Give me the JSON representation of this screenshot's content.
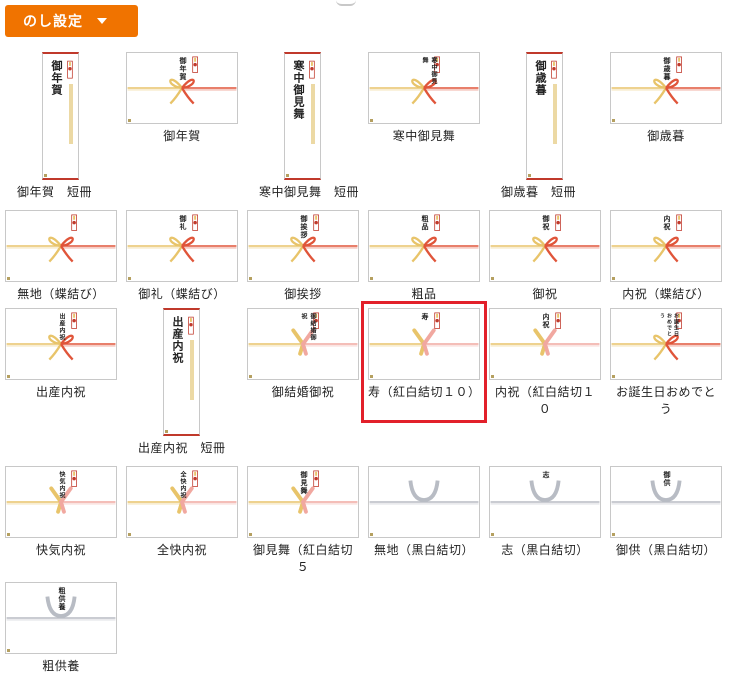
{
  "header": {
    "button_label": "のし設定"
  },
  "noshi": [
    {
      "caption": "御年賀　短冊",
      "text": "御年賀",
      "style": "tanzaku"
    },
    {
      "caption": "御年賀",
      "text": "御年賀",
      "style": "chou"
    },
    {
      "caption": "寒中御見舞　短冊",
      "text": "寒中御見舞",
      "style": "tanzaku"
    },
    {
      "caption": "寒中御見舞",
      "text": "寒中御見舞",
      "style": "chou"
    },
    {
      "caption": "御歳暮　短冊",
      "text": "御歳暮",
      "style": "tanzaku"
    },
    {
      "caption": "御歳暮",
      "text": "御歳暮",
      "style": "chou"
    },
    {
      "caption": "無地（蝶結び）",
      "text": "",
      "style": "chou"
    },
    {
      "caption": "御礼（蝶結び）",
      "text": "御礼",
      "style": "chou"
    },
    {
      "caption": "御挨拶",
      "text": "御挨拶",
      "style": "chou"
    },
    {
      "caption": "粗品",
      "text": "粗品",
      "style": "chou"
    },
    {
      "caption": "御祝",
      "text": "御祝",
      "style": "chou"
    },
    {
      "caption": "内祝（蝶結び）",
      "text": "内祝",
      "style": "chou"
    },
    {
      "caption": "出産内祝",
      "text": "出産内祝",
      "style": "chou"
    },
    {
      "caption": "出産内祝　短冊",
      "text": "出産内祝",
      "style": "tanzaku"
    },
    {
      "caption": "御結婚御祝",
      "text": "御結婚御祝",
      "style": "musubi"
    },
    {
      "caption": "寿（紅白結切１０）",
      "text": "寿",
      "style": "musubi"
    },
    {
      "caption": "内祝（紅白結切１０",
      "text": "内祝",
      "style": "musubi"
    },
    {
      "caption": "お誕生日おめでとう",
      "text": "お誕生日おめでとう",
      "style": "chou"
    },
    {
      "caption": "快気内祝",
      "text": "快気内祝",
      "style": "musubi"
    },
    {
      "caption": "全快内祝",
      "text": "全快内祝",
      "style": "musubi"
    },
    {
      "caption": "御見舞（紅白結切５",
      "text": "御見舞",
      "style": "musubi"
    },
    {
      "caption": "無地（黒白結切）",
      "text": "",
      "style": "kuro"
    },
    {
      "caption": "志（黒白結切）",
      "text": "志",
      "style": "kuro"
    },
    {
      "caption": "御供（黒白結切）",
      "text": "御供",
      "style": "kuro"
    },
    {
      "caption": "粗供養",
      "text": "粗供養",
      "style": "kuro"
    }
  ],
  "selected_index": 15,
  "colors": {
    "accent": "#f07300",
    "selection": "#e2202a",
    "red_mizuhiki": "#e0553a",
    "gold_mizuhiki": "#e8c46a",
    "pink_mizuhiki": "#f1a8a0",
    "gray_mizuhiki": "#b8bcc4"
  }
}
